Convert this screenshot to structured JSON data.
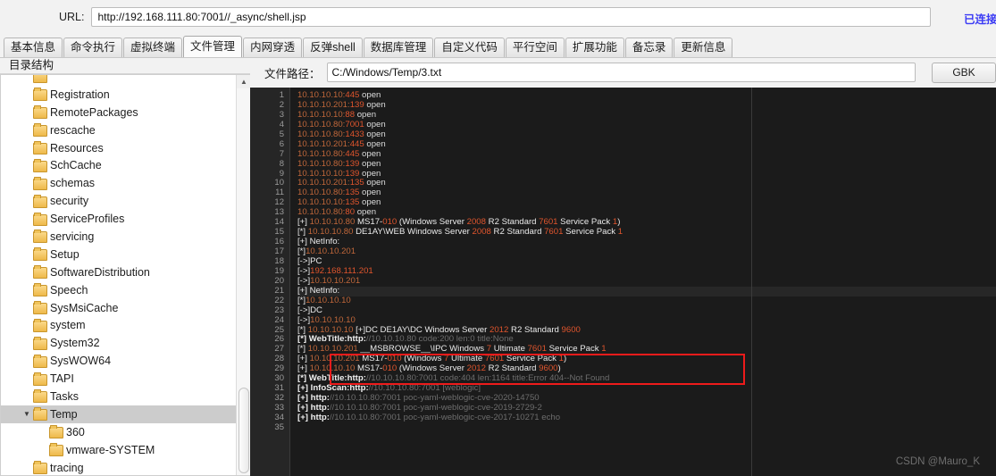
{
  "urlbar": {
    "label": "URL:",
    "value": "http://192.168.111.80:7001//_async/shell.jsp",
    "placeholder": "URL",
    "status": "已连接",
    "status_color": "#3b3bf5"
  },
  "tabs": [
    {
      "label": "基本信息",
      "active": false
    },
    {
      "label": "命令执行",
      "active": false
    },
    {
      "label": "虚拟终端",
      "active": false
    },
    {
      "label": "文件管理",
      "active": true
    },
    {
      "label": "内网穿透",
      "active": false
    },
    {
      "label": "反弹shell",
      "active": false
    },
    {
      "label": "数据库管理",
      "active": false
    },
    {
      "label": "自定义代码",
      "active": false
    },
    {
      "label": "平行空间",
      "active": false
    },
    {
      "label": "扩展功能",
      "active": false
    },
    {
      "label": "备忘录",
      "active": false
    },
    {
      "label": "更新信息",
      "active": false
    }
  ],
  "tree": {
    "header": "目录结构",
    "nodes": [
      {
        "label": "",
        "indent": 1,
        "twisty": "",
        "selected": false,
        "partial": true
      },
      {
        "label": "Registration",
        "indent": 1,
        "twisty": "",
        "selected": false
      },
      {
        "label": "RemotePackages",
        "indent": 1,
        "twisty": "",
        "selected": false
      },
      {
        "label": "rescache",
        "indent": 1,
        "twisty": "",
        "selected": false
      },
      {
        "label": "Resources",
        "indent": 1,
        "twisty": "",
        "selected": false
      },
      {
        "label": "SchCache",
        "indent": 1,
        "twisty": "",
        "selected": false
      },
      {
        "label": "schemas",
        "indent": 1,
        "twisty": "",
        "selected": false
      },
      {
        "label": "security",
        "indent": 1,
        "twisty": "",
        "selected": false
      },
      {
        "label": "ServiceProfiles",
        "indent": 1,
        "twisty": "",
        "selected": false
      },
      {
        "label": "servicing",
        "indent": 1,
        "twisty": "",
        "selected": false
      },
      {
        "label": "Setup",
        "indent": 1,
        "twisty": "",
        "selected": false
      },
      {
        "label": "SoftwareDistribution",
        "indent": 1,
        "twisty": "",
        "selected": false
      },
      {
        "label": "Speech",
        "indent": 1,
        "twisty": "",
        "selected": false
      },
      {
        "label": "SysMsiCache",
        "indent": 1,
        "twisty": "",
        "selected": false
      },
      {
        "label": "system",
        "indent": 1,
        "twisty": "",
        "selected": false
      },
      {
        "label": "System32",
        "indent": 1,
        "twisty": "",
        "selected": false
      },
      {
        "label": "SysWOW64",
        "indent": 1,
        "twisty": "",
        "selected": false
      },
      {
        "label": "TAPI",
        "indent": 1,
        "twisty": "",
        "selected": false
      },
      {
        "label": "Tasks",
        "indent": 1,
        "twisty": "",
        "selected": false
      },
      {
        "label": "Temp",
        "indent": 1,
        "twisty": "▼",
        "selected": true
      },
      {
        "label": "360",
        "indent": 2,
        "twisty": "",
        "selected": false
      },
      {
        "label": "vmware-SYSTEM",
        "indent": 2,
        "twisty": "",
        "selected": false
      },
      {
        "label": "tracing",
        "indent": 1,
        "twisty": "",
        "selected": false
      }
    ]
  },
  "pathrow": {
    "label": "文件路径：",
    "value": "C:/Windows/Temp/3.txt",
    "placeholder": "文件路径",
    "encoding_button": "GBK"
  },
  "editor": {
    "watermark": "CSDN @Mauro_K",
    "total_lines": 35,
    "highlight_box_lines": [
      27,
      28,
      29
    ],
    "lines": [
      {
        "n": 1,
        "segs": [
          [
            "ip",
            "10.10.10.10:"
          ],
          [
            "port",
            "445"
          ],
          [
            "ok",
            " open"
          ]
        ]
      },
      {
        "n": 2,
        "segs": [
          [
            "ip",
            "10.10.10.201:"
          ],
          [
            "port",
            "139"
          ],
          [
            "ok",
            " open"
          ]
        ]
      },
      {
        "n": 3,
        "segs": [
          [
            "ip",
            "10.10.10.10:"
          ],
          [
            "port",
            "88"
          ],
          [
            "ok",
            " open"
          ]
        ]
      },
      {
        "n": 4,
        "segs": [
          [
            "ip",
            "10.10.10.80:"
          ],
          [
            "port",
            "7001"
          ],
          [
            "ok",
            " open"
          ]
        ]
      },
      {
        "n": 5,
        "segs": [
          [
            "ip",
            "10.10.10.80:"
          ],
          [
            "port",
            "1433"
          ],
          [
            "ok",
            " open"
          ]
        ]
      },
      {
        "n": 6,
        "segs": [
          [
            "ip",
            "10.10.10.201:"
          ],
          [
            "port",
            "445"
          ],
          [
            "ok",
            " open"
          ]
        ]
      },
      {
        "n": 7,
        "segs": [
          [
            "ip",
            "10.10.10.80:"
          ],
          [
            "port",
            "445"
          ],
          [
            "ok",
            " open"
          ]
        ]
      },
      {
        "n": 8,
        "segs": [
          [
            "ip",
            "10.10.10.80:"
          ],
          [
            "port",
            "139"
          ],
          [
            "ok",
            " open"
          ]
        ]
      },
      {
        "n": 9,
        "segs": [
          [
            "ip",
            "10.10.10.10:"
          ],
          [
            "port",
            "139"
          ],
          [
            "ok",
            " open"
          ]
        ]
      },
      {
        "n": 10,
        "segs": [
          [
            "ip",
            "10.10.10.201:"
          ],
          [
            "port",
            "135"
          ],
          [
            "ok",
            " open"
          ]
        ]
      },
      {
        "n": 11,
        "segs": [
          [
            "ip",
            "10.10.10.80:"
          ],
          [
            "port",
            "135"
          ],
          [
            "ok",
            " open"
          ]
        ]
      },
      {
        "n": 12,
        "segs": [
          [
            "ip",
            "10.10.10.10:"
          ],
          [
            "port",
            "135"
          ],
          [
            "ok",
            " open"
          ]
        ]
      },
      {
        "n": 13,
        "segs": [
          [
            "ip",
            "10.10.10.80:"
          ],
          [
            "port",
            "80"
          ],
          [
            "ok",
            " open"
          ]
        ]
      },
      {
        "n": 14,
        "segs": [
          [
            "wht",
            "[+] "
          ],
          [
            "ip",
            "10.10.10.80"
          ],
          [
            "wht",
            " MS17-"
          ],
          [
            "num",
            "010"
          ],
          [
            "wht",
            "    (Windows Server "
          ],
          [
            "num",
            "2008"
          ],
          [
            "wht",
            " R2 Standard "
          ],
          [
            "num",
            "7601"
          ],
          [
            "wht",
            " Service Pack "
          ],
          [
            "num",
            "1"
          ],
          [
            "wht",
            ")"
          ]
        ]
      },
      {
        "n": 15,
        "segs": [
          [
            "wht",
            "[*] "
          ],
          [
            "ip",
            "10.10.10.80"
          ],
          [
            "wht",
            "         DE1AY\\WEB               Windows Server "
          ],
          [
            "num",
            "2008"
          ],
          [
            "wht",
            " R2 Standard "
          ],
          [
            "num",
            "7601"
          ],
          [
            "wht",
            " Service Pack "
          ],
          [
            "num",
            "1"
          ]
        ]
      },
      {
        "n": 16,
        "segs": [
          [
            "wht",
            "[+] NetInfo:"
          ]
        ]
      },
      {
        "n": 17,
        "segs": [
          [
            "wht",
            "[*]"
          ],
          [
            "ip",
            "10.10.10.201"
          ]
        ]
      },
      {
        "n": 18,
        "segs": [
          [
            "wht",
            "  [->]PC"
          ]
        ]
      },
      {
        "n": 19,
        "segs": [
          [
            "wht",
            "  [->]"
          ],
          [
            "port",
            "192.168.111.201"
          ]
        ]
      },
      {
        "n": 20,
        "segs": [
          [
            "wht",
            "  [->]"
          ],
          [
            "ip",
            "10.10.10.201"
          ]
        ]
      },
      {
        "n": 21,
        "segs": [
          [
            "wht",
            "[+] NetInfo:"
          ]
        ],
        "hl": true
      },
      {
        "n": 22,
        "segs": [
          [
            "wht",
            "[*]"
          ],
          [
            "ip",
            "10.10.10.10"
          ]
        ]
      },
      {
        "n": 23,
        "segs": [
          [
            "wht",
            "  [->]DC"
          ]
        ]
      },
      {
        "n": 24,
        "segs": [
          [
            "wht",
            "  [->]"
          ],
          [
            "ip",
            "10.10.10.10"
          ]
        ]
      },
      {
        "n": 25,
        "segs": [
          [
            "wht",
            "[*] "
          ],
          [
            "ip",
            "10.10.10.10"
          ],
          [
            "wht",
            "   [+]DC DE1AY\\DC             Windows Server "
          ],
          [
            "num",
            "2012"
          ],
          [
            "wht",
            " R2 Standard "
          ],
          [
            "num",
            "9600"
          ]
        ]
      },
      {
        "n": 26,
        "segs": [
          [
            "lbl",
            "[*] WebTitle:http:"
          ],
          [
            "dim",
            "//10.10.10.80      code:200 len:0     title:None"
          ]
        ]
      },
      {
        "n": 27,
        "segs": [
          [
            "wht",
            "[*] "
          ],
          [
            "ip",
            "10.10.10.201"
          ],
          [
            "wht",
            "        __MSBROWSE__\\IPC            Windows "
          ],
          [
            "num",
            "7"
          ],
          [
            "wht",
            " Ultimate "
          ],
          [
            "num",
            "7601"
          ],
          [
            "wht",
            " Service Pack "
          ],
          [
            "num",
            "1"
          ]
        ]
      },
      {
        "n": 28,
        "segs": [
          [
            "wht",
            "[+] "
          ],
          [
            "ip",
            "10.10.10.201"
          ],
          [
            "wht",
            "   MS17-"
          ],
          [
            "num",
            "010"
          ],
          [
            "wht",
            "   (Windows "
          ],
          [
            "num",
            "7"
          ],
          [
            "wht",
            " Ultimate "
          ],
          [
            "num",
            "7601"
          ],
          [
            "wht",
            " Service Pack "
          ],
          [
            "num",
            "1"
          ],
          [
            "wht",
            ")"
          ]
        ]
      },
      {
        "n": 29,
        "segs": [
          [
            "wht",
            "[+] "
          ],
          [
            "ip",
            "10.10.10.10"
          ],
          [
            "wht",
            " MS17-"
          ],
          [
            "num",
            "010"
          ],
          [
            "wht",
            "   (Windows Server "
          ],
          [
            "num",
            "2012"
          ],
          [
            "wht",
            " R2 Standard "
          ],
          [
            "num",
            "9600"
          ],
          [
            "wht",
            ")"
          ]
        ]
      },
      {
        "n": 30,
        "segs": [
          [
            "lbl",
            "[*] WebTitle:http:"
          ],
          [
            "dim",
            "//10.10.10.80:7001   code:404 len:1164   title:Error 404--Not Found"
          ]
        ]
      },
      {
        "n": 31,
        "segs": [
          [
            "lbl",
            "[+] InfoScan:http:"
          ],
          [
            "dim",
            "//10.10.10.80:7001   [weblogic]"
          ]
        ]
      },
      {
        "n": 32,
        "segs": [
          [
            "lbl",
            "[+] http:"
          ],
          [
            "dim",
            "//10.10.10.80:7001 poc-yaml-weblogic-cve-2020-14750"
          ]
        ]
      },
      {
        "n": 33,
        "segs": [
          [
            "lbl",
            "[+] http:"
          ],
          [
            "dim",
            "//10.10.10.80:7001 poc-yaml-weblogic-cve-2019-2729-2"
          ]
        ]
      },
      {
        "n": 34,
        "segs": [
          [
            "lbl",
            "[+] http:"
          ],
          [
            "dim",
            "//10.10.10.80:7001 poc-yaml-weblogic-cve-2017-10271 echo"
          ]
        ]
      },
      {
        "n": 35,
        "segs": []
      }
    ]
  }
}
